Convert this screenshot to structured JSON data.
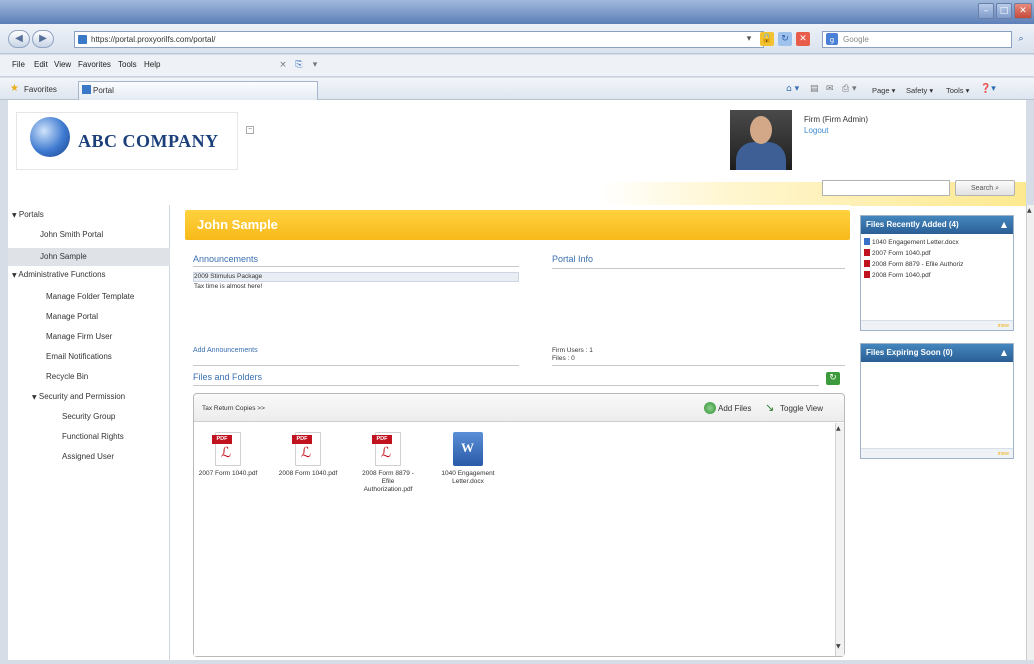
{
  "browser": {
    "url": "https://portal.proxyorilfs.com/portal/",
    "search_placeholder": "Google",
    "menu": [
      "File",
      "Edit",
      "View",
      "Favorites",
      "Tools",
      "Help"
    ],
    "favorites_label": "Favorites",
    "tab_title": "Portal",
    "command_bar": [
      "Page ▾",
      "Safety ▾",
      "Tools ▾"
    ]
  },
  "header": {
    "company": "ABC COMPANY",
    "user_name": "Firm (Firm Admin)",
    "logout": "Logout",
    "search_button": "Search"
  },
  "sidebar": {
    "portals_label": "Portals",
    "portals": [
      "John Smith Portal",
      "John Sample"
    ],
    "admin_label": "Administrative Functions",
    "admin_items": [
      "Manage Folder Template",
      "Manage Portal",
      "Manage Firm User",
      "Email Notifications",
      "Recycle Bin"
    ],
    "security_label": "Security and Permission",
    "security_items": [
      "Security Group",
      "Functional Rights",
      "Assigned User"
    ]
  },
  "main": {
    "portal_title": "John Sample",
    "announcements_title": "Announcements",
    "announcements": [
      "2009 Stimulus Package",
      "Tax time is almost here!"
    ],
    "add_announcements": "Add Announcements",
    "portal_info_title": "Portal Info",
    "firm_users": "Firm Users : 1",
    "files_count": "Files : 0",
    "files_folders_title": "Files and Folders",
    "breadcrumb": "Tax Return Copies >>",
    "add_files": "Add Files",
    "toggle_view": "Toggle View",
    "files": [
      {
        "name": "2007 Form 1040.pdf",
        "type": "pdf"
      },
      {
        "name": "2008 Form 1040.pdf",
        "type": "pdf"
      },
      {
        "name": "2008 Form 8879 - Efile Authorization.pdf",
        "type": "pdf"
      },
      {
        "name": "1040 Engagement Letter.docx",
        "type": "docx"
      }
    ]
  },
  "widgets": {
    "recent_title": "Files Recently Added (4)",
    "recent_files": [
      "1040 Engagement Letter.docx",
      "2007 Form 1040.pdf",
      "2008 Form 8879 - Efile Authoriz",
      "2008 Form 1040.pdf"
    ],
    "expiring_title": "Files Expiring Soon (0)",
    "more": "more"
  }
}
